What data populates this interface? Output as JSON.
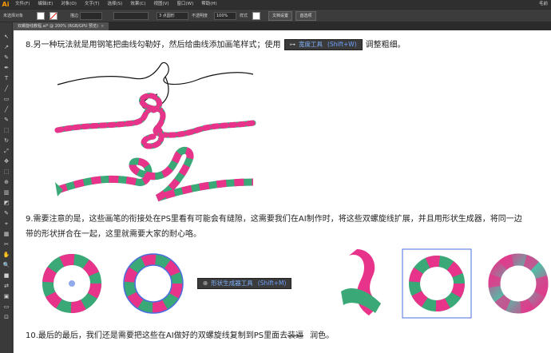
{
  "app": {
    "logo": "Ai",
    "menus": [
      "文件(F)",
      "编辑(E)",
      "对象(O)",
      "文字(T)",
      "选择(S)",
      "效果(C)",
      "视图(V)",
      "窗口(W)",
      "帮助(H)"
    ],
    "right_label": "毛前"
  },
  "controlbar": {
    "selection_label": "未选择对象",
    "stroke_label": "描边",
    "stroke_value": "3 点圆形",
    "opacity_label": "不透明度",
    "opacity_value": "100%",
    "style_label": "样式",
    "doc_setup_button": "文档设置",
    "prefs_button": "首选项"
  },
  "tab": {
    "title": "双螺旋线教程.ai* @ 200% (RGB/GPU 预览)",
    "close": "×"
  },
  "tools": [
    "↖",
    "↗",
    "✎",
    "✒",
    "T",
    "╱",
    "▭",
    "╱",
    "✎",
    "⬚",
    "↻",
    "⤢",
    "✥",
    "⬚",
    "⊕",
    "▥",
    "◩",
    "✎",
    "⌖",
    "▦",
    "✂",
    "✋",
    "🔍",
    "■",
    "⇄",
    "▣",
    "▭",
    "⊡"
  ],
  "article": {
    "para8_before": "8.另一种玩法就是用钢笔把曲线勾勒好，然后给曲线添加画笔样式；使用",
    "width_tool_name": "宽度工具",
    "width_tool_hotkey": "(Shift+W)",
    "para8_after": "调整粗细。",
    "para9_line1": "9.需要注意的是，这些画笔的衔接处在PS里看有可能会有缝隙，这需要我们在AI制作时，将这些双螺旋线扩展，并且用形状生成器，将同一边",
    "para9_line2": "带的形状拼合在一起，这里就需要大家的耐心咯。",
    "shape_tool_name": "形状生成器工具",
    "shape_tool_hotkey": "(Shift+M)",
    "para10_before": "10.最后的最后，我们还是需要把这些在AI做好的双螺旋线复制到PS里面去",
    "para10_struck": "装逼",
    "para10_after": "润色。"
  },
  "colors": {
    "pink": "#e8338a",
    "green": "#3aa877",
    "teal": "#4cc2a8",
    "blue_sel": "#4a6fe0"
  }
}
